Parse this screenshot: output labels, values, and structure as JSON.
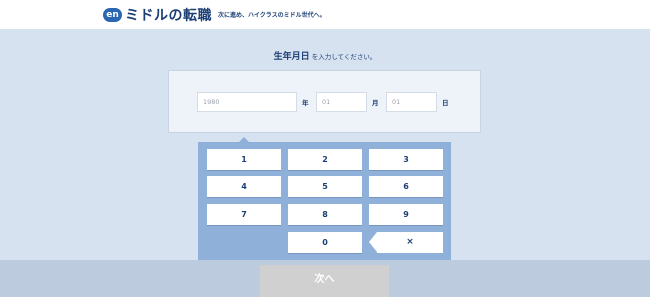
{
  "header": {
    "logo_badge": "en",
    "logo_text": "ミドルの転職",
    "tagline": "次に進め、ハイクラスのミドル世代へ。"
  },
  "prompt": {
    "strong": "生年月日",
    "rest": " を入力してください。"
  },
  "fields": {
    "year": {
      "placeholder": "1980",
      "unit": "年"
    },
    "month": {
      "placeholder": "01",
      "unit": "月"
    },
    "day": {
      "placeholder": "01",
      "unit": "日"
    }
  },
  "keypad": {
    "keys": [
      "1",
      "2",
      "3",
      "4",
      "5",
      "6",
      "7",
      "8",
      "9",
      "0"
    ],
    "backspace": "×"
  },
  "next_button": "次へ",
  "colors": {
    "background": "#d6e2ef",
    "brand": "#1b3f75",
    "keypad": "#8fb0d9",
    "disabled_button": "#d0d0d0"
  }
}
